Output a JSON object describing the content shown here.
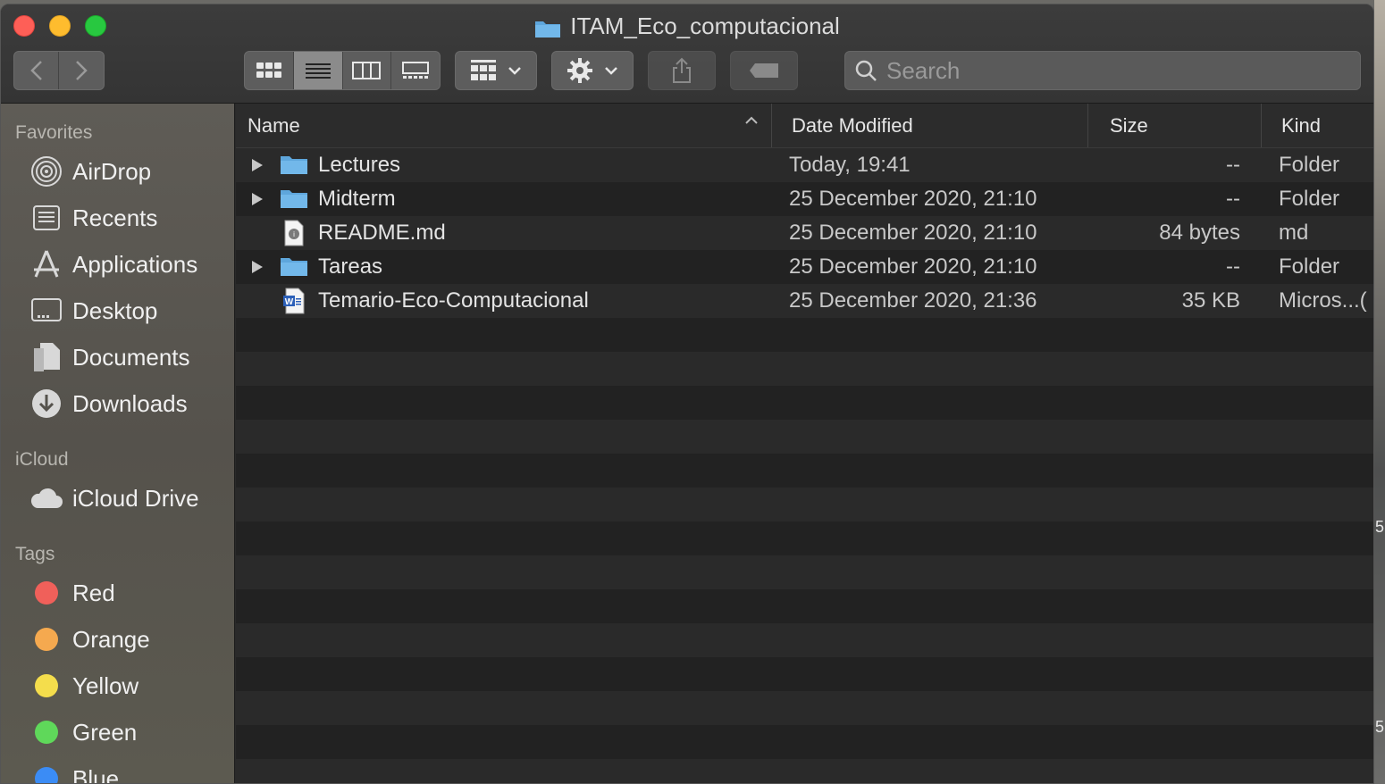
{
  "window": {
    "title": "ITAM_Eco_computacional"
  },
  "toolbar": {
    "search_placeholder": "Search"
  },
  "sidebar": {
    "favorites_label": "Favorites",
    "favorites": [
      {
        "label": "AirDrop",
        "icon": "airdrop-icon"
      },
      {
        "label": "Recents",
        "icon": "recents-icon"
      },
      {
        "label": "Applications",
        "icon": "applications-icon"
      },
      {
        "label": "Desktop",
        "icon": "desktop-icon"
      },
      {
        "label": "Documents",
        "icon": "documents-icon"
      },
      {
        "label": "Downloads",
        "icon": "downloads-icon"
      }
    ],
    "icloud_label": "iCloud",
    "icloud": [
      {
        "label": "iCloud Drive",
        "icon": "cloud-icon"
      }
    ],
    "tags_label": "Tags",
    "tags": [
      {
        "label": "Red",
        "color": "#f0605a"
      },
      {
        "label": "Orange",
        "color": "#f5a94f"
      },
      {
        "label": "Yellow",
        "color": "#f4dd4c"
      },
      {
        "label": "Green",
        "color": "#5fd85a"
      },
      {
        "label": "Blue",
        "color": "#3b8cf5"
      }
    ]
  },
  "list": {
    "columns": {
      "name": "Name",
      "date": "Date Modified",
      "size": "Size",
      "kind": "Kind"
    },
    "rows": [
      {
        "name": "Lectures",
        "date": "Today, 19:41",
        "size": "--",
        "kind": "Folder",
        "type": "folder"
      },
      {
        "name": "Midterm",
        "date": "25 December 2020, 21:10",
        "size": "--",
        "kind": "Folder",
        "type": "folder"
      },
      {
        "name": "README.md",
        "date": "25 December 2020, 21:10",
        "size": "84 bytes",
        "kind": "md",
        "type": "md"
      },
      {
        "name": "Tareas",
        "date": "25 December 2020, 21:10",
        "size": "--",
        "kind": "Folder",
        "type": "folder"
      },
      {
        "name": "Temario-Eco-Computacional",
        "date": "25 December 2020, 21:36",
        "size": "35 KB",
        "kind": "Micros...(",
        "type": "word"
      }
    ]
  },
  "desktop": {
    "edge_digits": [
      "5",
      "5"
    ]
  }
}
